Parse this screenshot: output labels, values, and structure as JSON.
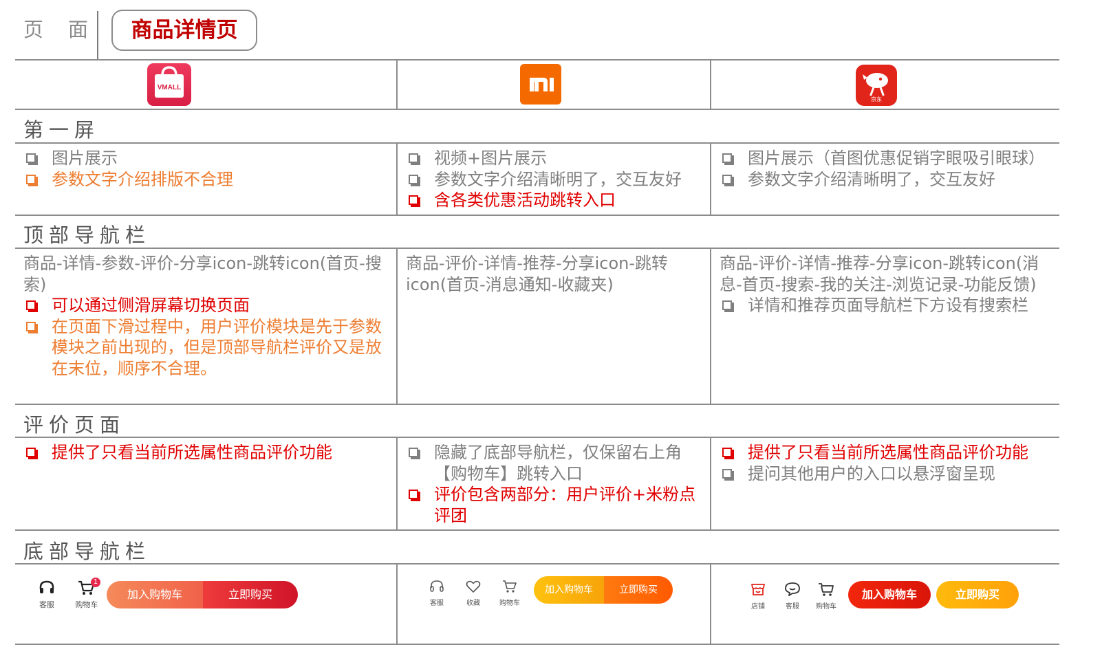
{
  "header": {
    "page_label": "页面",
    "title": "商品详情页"
  },
  "columns": [
    {
      "logo_icon": "vmall-logo-icon",
      "logo_text": "VMALL",
      "color": "#e6294d"
    },
    {
      "logo_icon": "mi-logo-icon",
      "logo_text": "mi",
      "color": "#f56a00"
    },
    {
      "logo_icon": "jd-logo-icon",
      "logo_text": "京东",
      "color": "#e1251b"
    }
  ],
  "sections": {
    "first_screen": {
      "title": "第一屏",
      "cells": [
        [
          {
            "text": "图片展示",
            "color": "gray"
          },
          {
            "text": "参数文字介绍排版不合理",
            "color": "orange"
          }
        ],
        [
          {
            "text": "视频+图片展示",
            "color": "gray"
          },
          {
            "text": "参数文字介绍清晰明了，交互友好",
            "color": "gray"
          },
          {
            "text": "含各类优惠活动跳转入口",
            "color": "red"
          }
        ],
        [
          {
            "text": "图片展示（首图优惠促销字眼吸引眼球）",
            "color": "gray"
          },
          {
            "text": "参数文字介绍清晰明了，交互友好",
            "color": "gray"
          }
        ]
      ]
    },
    "top_nav": {
      "title": "顶部导航栏",
      "cells": [
        {
          "plain": "商品-详情-参数-评价-分享icon-跳转icon(首页-搜索)",
          "items": [
            {
              "text": "可以通过侧滑屏幕切换页面",
              "color": "red"
            },
            {
              "text": "在页面下滑过程中，用户评价模块是先于参数模块之前出现的，但是顶部导航栏评价又是放在末位，顺序不合理。",
              "color": "orange"
            }
          ]
        },
        {
          "plain": "商品-评价-详情-推荐-分享icon-跳转icon(首页-消息通知-收藏夹)",
          "items": []
        },
        {
          "plain": "商品-评价-详情-推荐-分享icon-跳转icon(消息-首页-搜索-我的关注-浏览记录-功能反馈)",
          "items": [
            {
              "text": "详情和推荐页面导航栏下方设有搜索栏",
              "color": "gray"
            }
          ]
        }
      ]
    },
    "reviews": {
      "title": "评价页面",
      "cells": [
        [
          {
            "text": "提供了只看当前所选属性商品评价功能",
            "color": "red"
          }
        ],
        [
          {
            "text": "隐藏了底部导航栏，仅保留右上角【购物车】跳转入口",
            "color": "gray"
          },
          {
            "text": "评价包含两部分：用户评价+米粉点评团",
            "color": "red"
          }
        ],
        [
          {
            "text": "提供了只看当前所选属性商品评价功能",
            "color": "red"
          },
          {
            "text": "提问其他用户的入口以悬浮窗呈现",
            "color": "gray"
          }
        ]
      ]
    },
    "bottom_nav": {
      "title": "底部导航栏",
      "vmall": {
        "service": "客服",
        "cart": "购物车",
        "cart_badge": "1",
        "add_cart": "加入购物车",
        "buy_now": "立即购买"
      },
      "mi": {
        "service": "客服",
        "favorite": "收藏",
        "cart": "购物车",
        "add_cart": "加入购物车",
        "buy_now": "立即购买"
      },
      "jd": {
        "shop": "店铺",
        "service": "客服",
        "cart": "购物车",
        "add_cart": "加入购物车",
        "buy_now": "立即购买"
      }
    }
  }
}
